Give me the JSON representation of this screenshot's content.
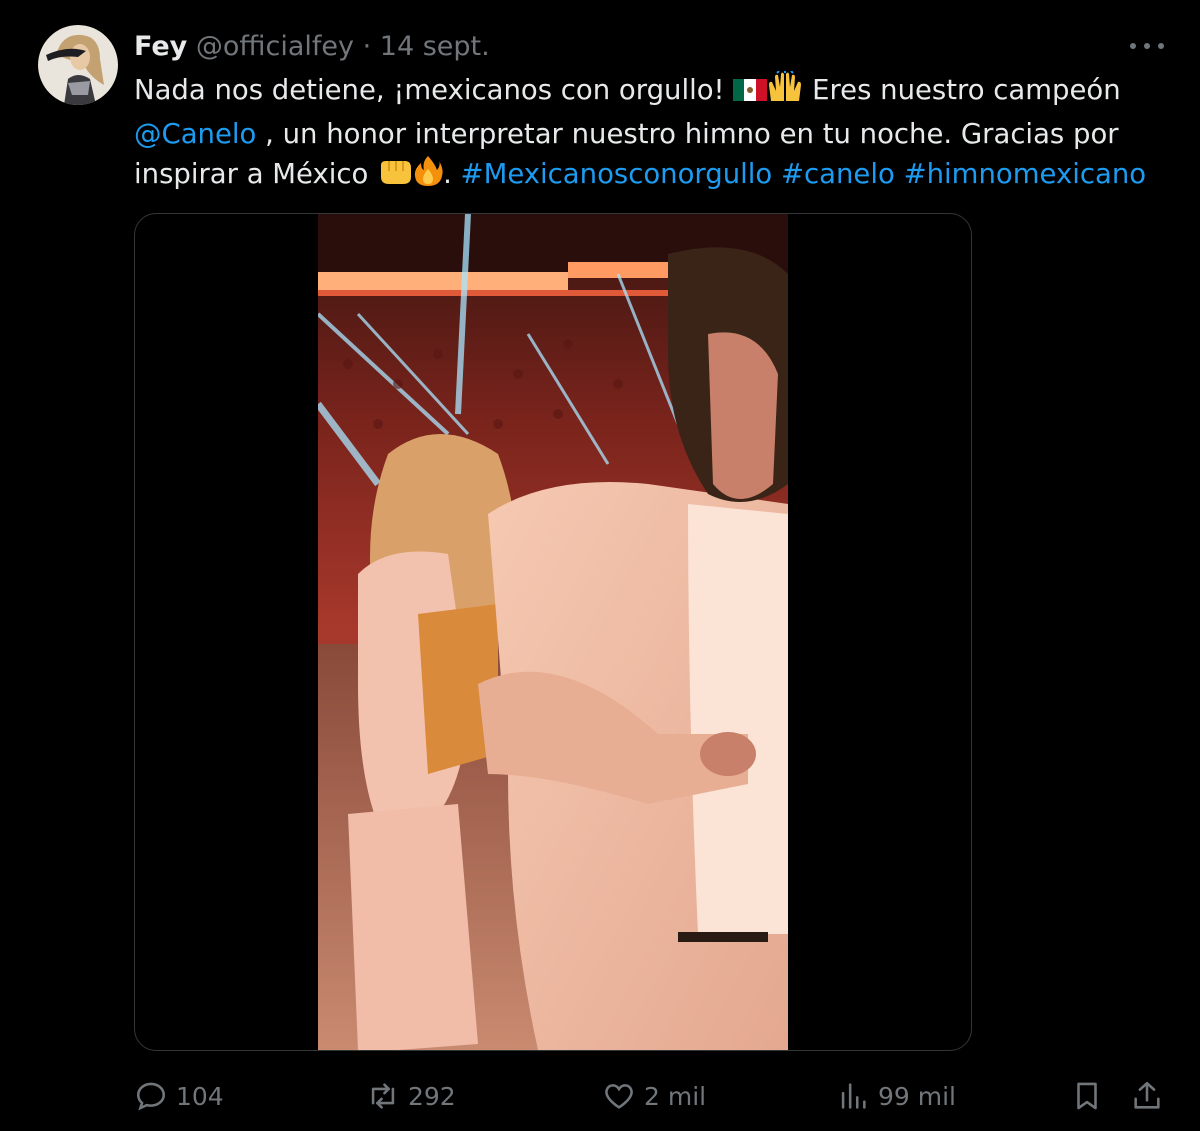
{
  "author": {
    "name": "Fey",
    "handle": "@officialfey",
    "separator": "·",
    "date": "14 sept."
  },
  "tweet": {
    "text_1": "Nada nos detiene, ¡mexicanos con orgullo! ",
    "text_2": " Eres nuestro campeón ",
    "mention": "@Canelo",
    "text_3": " , un honor interpretar nuestro himno en tu noche. Gracias por inspirar a México ",
    "text_4": ". ",
    "hashtags": [
      "#Mexicanosconorgullo",
      "#canelo",
      "#himnomexicano"
    ],
    "emojis": [
      "mexico-flag",
      "raising-hands",
      "oncoming-fist",
      "fire"
    ]
  },
  "stats": {
    "replies": "104",
    "reposts": "292",
    "likes": "2 mil",
    "views": "99 mil"
  },
  "colors": {
    "background": "#000000",
    "text": "#e7e9ea",
    "muted": "#71767b",
    "link": "#1d9bf0",
    "border": "#333639"
  }
}
